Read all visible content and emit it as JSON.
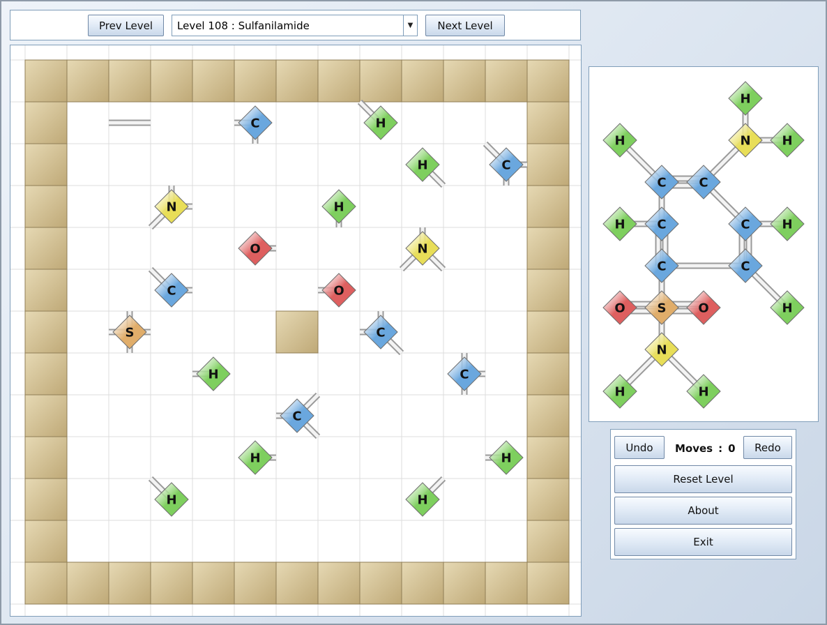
{
  "header": {
    "prev_label": "Prev Level",
    "next_label": "Next Level",
    "level_selected": "Level 108 : Sulfanilamide"
  },
  "controls": {
    "undo_label": "Undo",
    "redo_label": "Redo",
    "moves_label": "Moves",
    "moves_sep": ":",
    "moves_count": "0",
    "reset_label": "Reset Level",
    "about_label": "About",
    "exit_label": "Exit"
  },
  "colors": {
    "H": "#7ecf5e",
    "C": "#6aa7de",
    "N": "#e8de58",
    "O": "#de5f5f",
    "S": "#e0ad6a",
    "wall": "#cfbd8f",
    "grid": "#dcdcdc"
  },
  "board": {
    "cols": 14,
    "rows": 14,
    "inner_walls": [
      [
        6,
        6
      ]
    ],
    "atoms": [
      {
        "el": "C",
        "c": 5,
        "r": 1,
        "bonds": [
          "W",
          "S"
        ]
      },
      {
        "el": "H",
        "c": 8,
        "r": 1,
        "bonds": [
          "NW"
        ]
      },
      {
        "el": "H",
        "c": 9,
        "r": 2,
        "bonds": [
          "SE"
        ]
      },
      {
        "el": "C",
        "c": 11,
        "r": 2,
        "bonds": [
          "NW",
          "E",
          "S"
        ]
      },
      {
        "el": "N",
        "c": 3,
        "r": 3,
        "bonds": [
          "N",
          "E",
          "SW"
        ]
      },
      {
        "el": "H",
        "c": 7,
        "r": 3,
        "bonds": [
          "S"
        ]
      },
      {
        "el": "O",
        "c": 5,
        "r": 4,
        "bonds": [
          "E"
        ]
      },
      {
        "el": "N",
        "c": 9,
        "r": 4,
        "bonds": [
          "N",
          "SW",
          "SE"
        ]
      },
      {
        "el": "C",
        "c": 3,
        "r": 5,
        "bonds": [
          "NW",
          "E"
        ]
      },
      {
        "el": "O",
        "c": 7,
        "r": 5,
        "bonds": [
          "W"
        ]
      },
      {
        "el": "S",
        "c": 2,
        "r": 6,
        "bonds": [
          "N",
          "W",
          "E",
          "S"
        ]
      },
      {
        "el": "C",
        "c": 8,
        "r": 6,
        "bonds": [
          "N",
          "W",
          "SE"
        ]
      },
      {
        "el": "H",
        "c": 4,
        "r": 7,
        "bonds": [
          "W"
        ]
      },
      {
        "el": "C",
        "c": 10,
        "r": 7,
        "bonds": [
          "N",
          "E",
          "S"
        ]
      },
      {
        "el": "C",
        "c": 6,
        "r": 8,
        "bonds": [
          "W",
          "NE",
          "SE"
        ]
      },
      {
        "el": "H",
        "c": 5,
        "r": 9,
        "bonds": [
          "E"
        ]
      },
      {
        "el": "H",
        "c": 11,
        "r": 9,
        "bonds": [
          "W"
        ]
      },
      {
        "el": "H",
        "c": 3,
        "r": 10,
        "bonds": [
          "NW"
        ]
      },
      {
        "el": "H",
        "c": 9,
        "r": 10,
        "bonds": [
          "NE"
        ]
      }
    ],
    "loose_bonds": [
      {
        "c": 2,
        "r": 1,
        "dir": "H"
      }
    ]
  },
  "target": {
    "atoms": [
      {
        "id": "h1",
        "el": "H",
        "c": 3,
        "r": 0
      },
      {
        "id": "h2",
        "el": "H",
        "c": 0,
        "r": 1
      },
      {
        "id": "n1",
        "el": "N",
        "c": 3,
        "r": 1
      },
      {
        "id": "h3",
        "el": "H",
        "c": 4,
        "r": 1
      },
      {
        "id": "c1",
        "el": "C",
        "c": 1,
        "r": 2
      },
      {
        "id": "c2",
        "el": "C",
        "c": 2,
        "r": 2
      },
      {
        "id": "h4",
        "el": "H",
        "c": 0,
        "r": 3
      },
      {
        "id": "c3",
        "el": "C",
        "c": 1,
        "r": 3
      },
      {
        "id": "c4",
        "el": "C",
        "c": 3,
        "r": 3
      },
      {
        "id": "h5",
        "el": "H",
        "c": 4,
        "r": 3
      },
      {
        "id": "c5",
        "el": "C",
        "c": 1,
        "r": 4
      },
      {
        "id": "c6",
        "el": "C",
        "c": 3,
        "r": 4
      },
      {
        "id": "o1",
        "el": "O",
        "c": 0,
        "r": 5
      },
      {
        "id": "s1",
        "el": "S",
        "c": 1,
        "r": 5
      },
      {
        "id": "o2",
        "el": "O",
        "c": 2,
        "r": 5
      },
      {
        "id": "h6",
        "el": "H",
        "c": 4,
        "r": 5
      },
      {
        "id": "n2",
        "el": "N",
        "c": 1,
        "r": 6
      },
      {
        "id": "h7",
        "el": "H",
        "c": 0,
        "r": 7
      },
      {
        "id": "h8",
        "el": "H",
        "c": 2,
        "r": 7
      }
    ],
    "bonds": [
      [
        "h1",
        "n1",
        1
      ],
      [
        "n1",
        "h3",
        1
      ],
      [
        "n1",
        "c2",
        1
      ],
      [
        "h2",
        "c1",
        1
      ],
      [
        "c1",
        "c2",
        2
      ],
      [
        "c1",
        "c3",
        1
      ],
      [
        "c2",
        "c4",
        1
      ],
      [
        "h4",
        "c3",
        1
      ],
      [
        "c3",
        "c5",
        2
      ],
      [
        "c4",
        "h5",
        1
      ],
      [
        "c4",
        "c6",
        2
      ],
      [
        "c5",
        "c6",
        1
      ],
      [
        "c5",
        "s1",
        1
      ],
      [
        "c6",
        "h6",
        1
      ],
      [
        "o1",
        "s1",
        2
      ],
      [
        "s1",
        "o2",
        2
      ],
      [
        "s1",
        "n2",
        1
      ],
      [
        "n2",
        "h7",
        1
      ],
      [
        "n2",
        "h8",
        1
      ]
    ]
  }
}
